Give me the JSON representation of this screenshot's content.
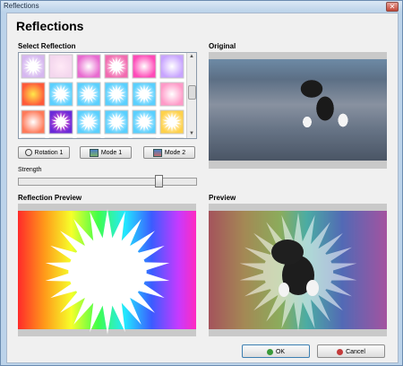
{
  "window": {
    "title": "Reflections",
    "close_glyph": "✕"
  },
  "dialog": {
    "title": "Reflections"
  },
  "select_reflection": {
    "label": "Select Reflection"
  },
  "original": {
    "label": "Original"
  },
  "buttons": {
    "rotation": "Rotation 1",
    "mode1": "Mode 1",
    "mode2": "Mode 2",
    "ok": "OK",
    "cancel": "Cancel"
  },
  "strength": {
    "label": "Strength",
    "value_fraction": 0.8
  },
  "reflection_preview": {
    "label": "Reflection Preview"
  },
  "preview": {
    "label": "Preview"
  },
  "thumbnails": [
    "burst-white",
    "light-pink",
    "pink-radial",
    "rose-burst",
    "magenta-glow",
    "rainbow-soft",
    "rainbow-bands",
    "rainbow-star",
    "rainbow-star",
    "rainbow-star",
    "rainbow-star",
    "white-circle",
    "white-glow",
    "purple-burst",
    "rainbow-star",
    "rainbow-star",
    "rainbow-star",
    "rainbow-burst",
    "rainbow-partial",
    "rainbow-partial",
    "rainbow-partial",
    "rainbow-partial",
    "rainbow-partial",
    "rainbow-partial"
  ],
  "icons": {
    "rotation": "rotate-icon",
    "mode1": "image-icon",
    "mode2": "image-icon",
    "ok": "check-icon",
    "cancel": "cancel-icon"
  }
}
